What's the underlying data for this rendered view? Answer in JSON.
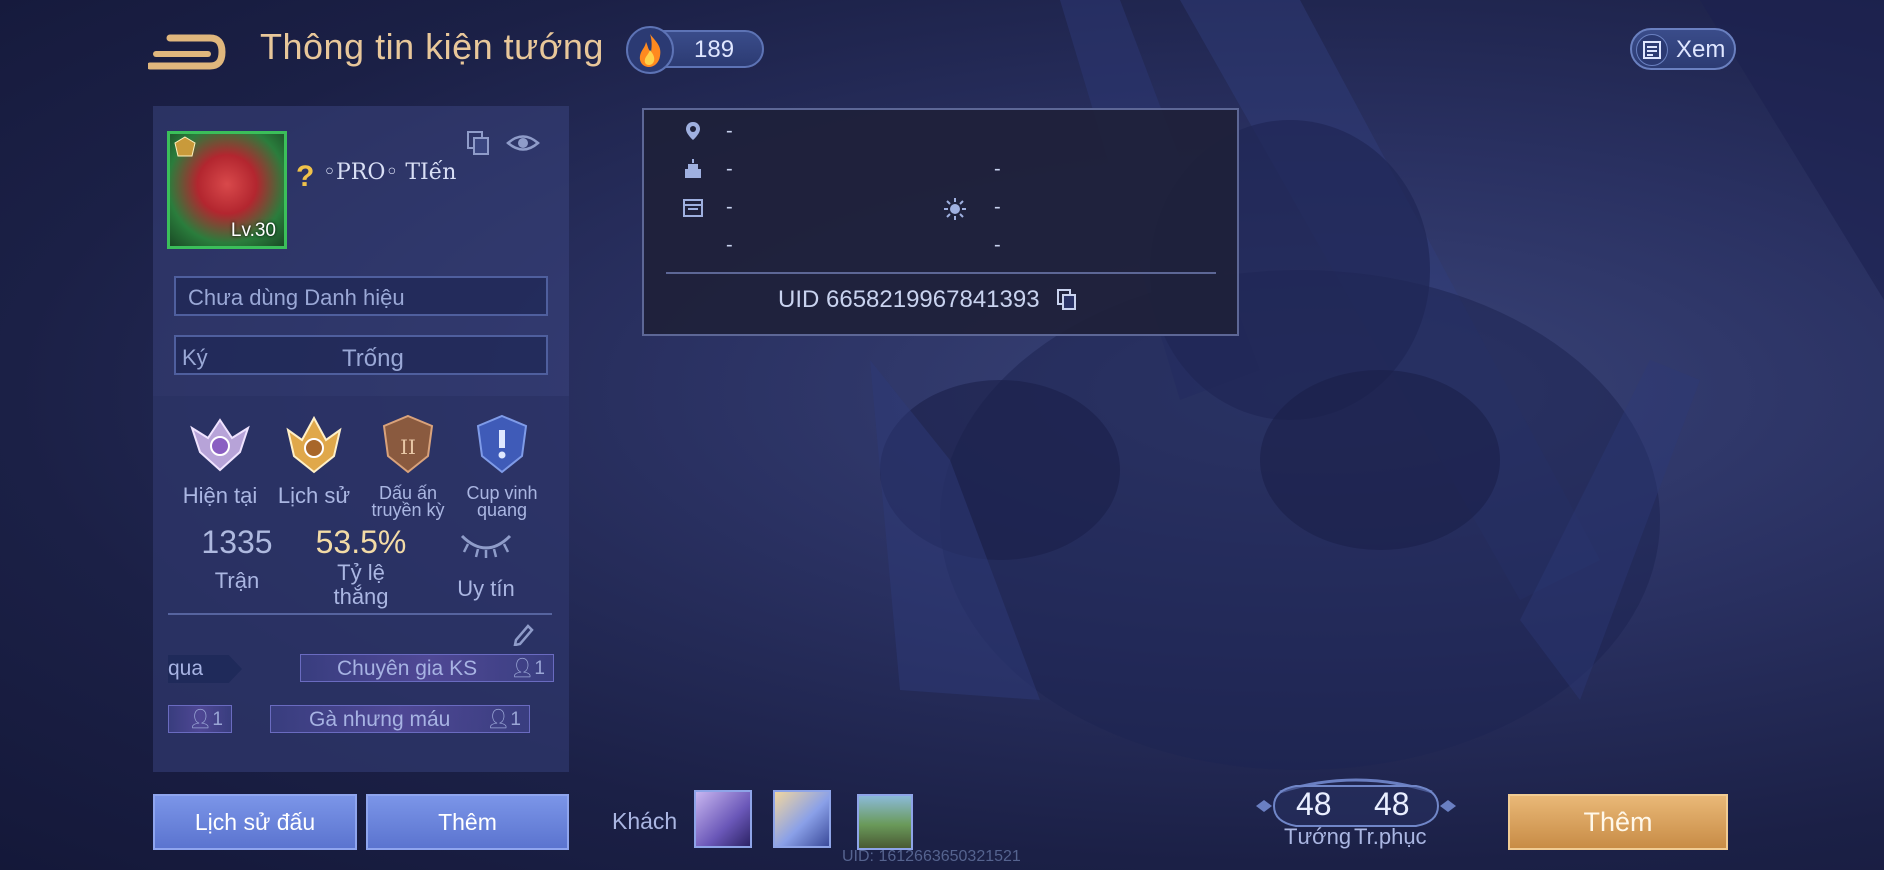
{
  "header": {
    "title": "Thông tin kiện tướng",
    "fire_count": "189",
    "view_label": "Xem"
  },
  "profile": {
    "level": "Lv.30",
    "question_mark": "?",
    "name": "◦PRO◦ TIến",
    "title_placeholder": "Chưa dùng Danh hiệu",
    "signature_label": "Ký",
    "signature_value": "Trống"
  },
  "ranks": [
    {
      "label": "Hiện tại"
    },
    {
      "label": "Lịch sử"
    },
    {
      "label": "Dấu ấn truyền kỳ"
    },
    {
      "label": "Cup vinh quang"
    }
  ],
  "stats": {
    "matches_value": "1335",
    "matches_label": "Trận",
    "winrate_value": "53.5%",
    "winrate_label": "Tỷ lệ thắng",
    "reputation_label": "Uy tín"
  },
  "tags": {
    "left_partial": "qua",
    "expert": "Chuyên gia KS",
    "expert_count": "1",
    "small_count": "1",
    "chicken": "Gà nhưng máu",
    "chicken_count": "1"
  },
  "info": {
    "location": "-",
    "birthday": "-",
    "birthday_right": "-",
    "date": "-",
    "date_right": "-",
    "extra": "-",
    "extra_right": "-",
    "uid": "UID 6658219967841393"
  },
  "bottom": {
    "history_button": "Lịch sử đấu",
    "more_button": "Thêm",
    "guest_label": "Khách",
    "guest_uid": "UID: 1612663650321521",
    "heroes_count": "48",
    "heroes_label": "Tướng",
    "skins_count": "48",
    "skins_label": "Tr.phục",
    "add_button": "Thêm"
  },
  "colors": {
    "accent_gold": "#e8c79a",
    "button_blue": "#6b85de",
    "button_gold": "#d9a25e",
    "panel": "#2a3366"
  }
}
